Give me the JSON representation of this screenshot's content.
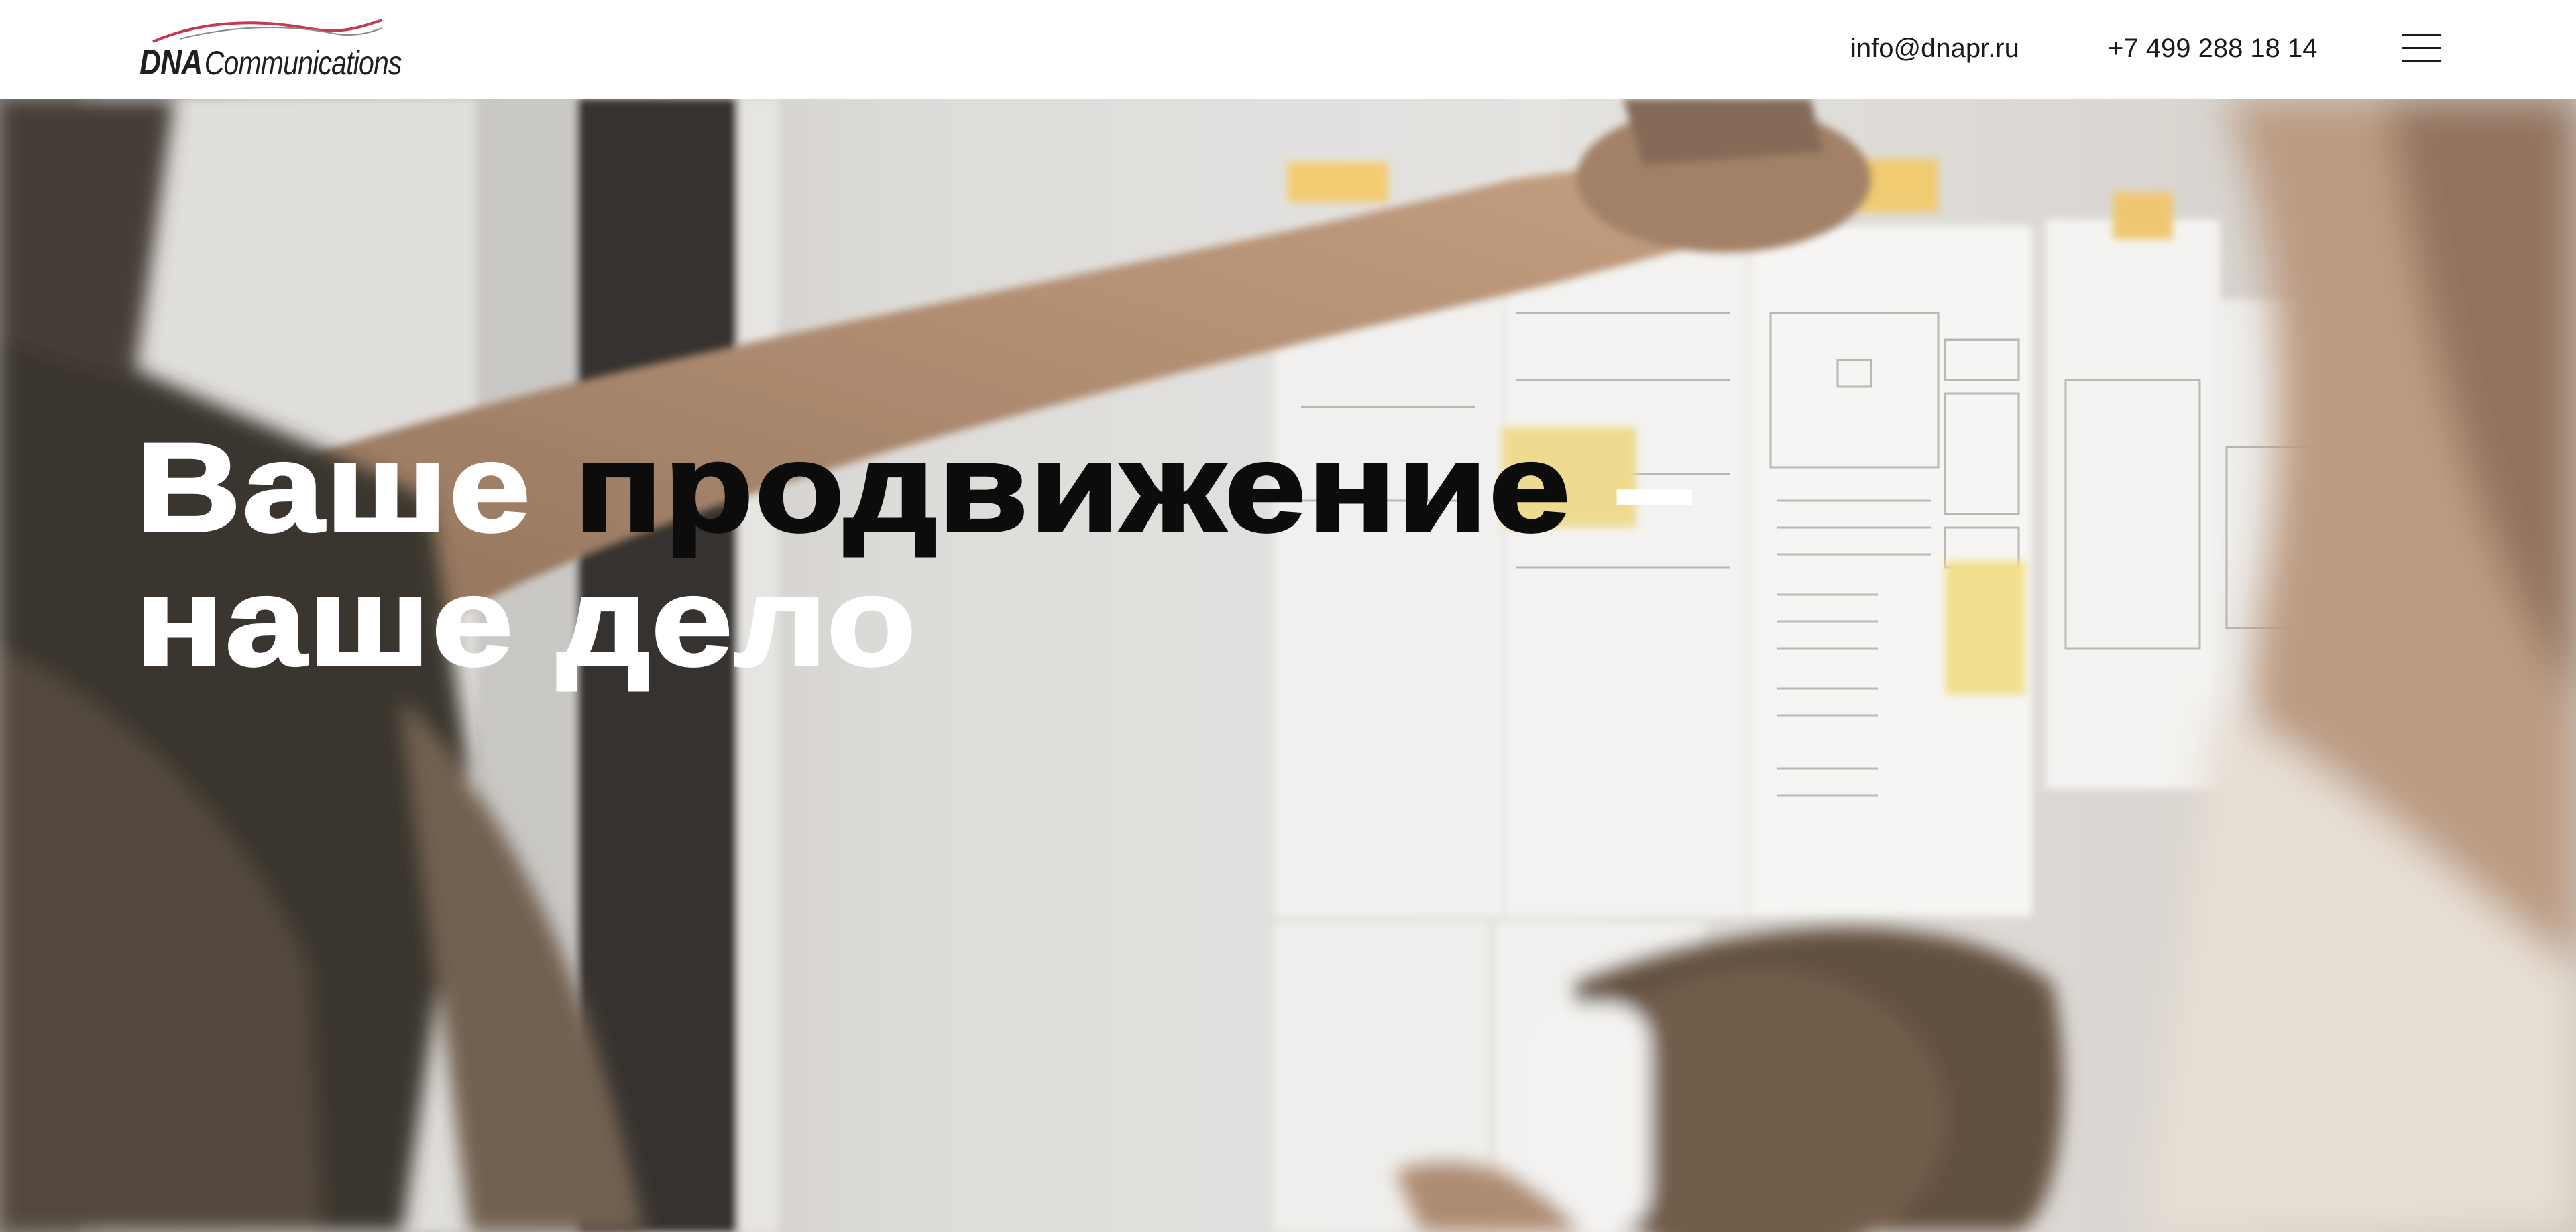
{
  "header": {
    "logo": {
      "brand_bold": "DNA",
      "brand_rest": "Communications",
      "accent_color": "#c8384f"
    },
    "email": "info@dnapr.ru",
    "phone": "+7 499 288 18 14",
    "menu_icon": "hamburger-menu-icon"
  },
  "hero": {
    "title_line1_part1": "Ваше ",
    "title_line1_part2": "продвижение",
    "title_line1_part3": " –",
    "title_line2": "наше дело",
    "background": "photo of people arranging paper sketches and sticky notes on a wall"
  }
}
